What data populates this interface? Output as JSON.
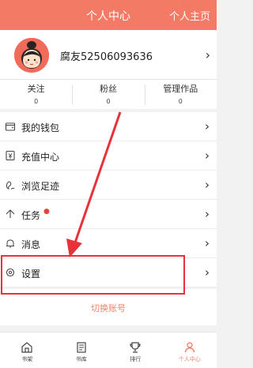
{
  "header": {
    "title": "个人中心",
    "homepage_link": "个人主页"
  },
  "profile": {
    "username": "腐友52506093636",
    "avatar_icon": "cartoon-avatar-icon"
  },
  "stats": [
    {
      "label": "关注",
      "value": "0"
    },
    {
      "label": "粉丝",
      "value": "0"
    },
    {
      "label": "管理作品",
      "value": "0"
    }
  ],
  "menu": [
    {
      "label": "我的钱包",
      "icon": "wallet-icon"
    },
    {
      "label": "充值中心",
      "icon": "recharge-icon"
    },
    {
      "label": "浏览足迹",
      "icon": "footprint-icon"
    },
    {
      "label": "任务",
      "icon": "task-icon",
      "badge": "●"
    },
    {
      "label": "消息",
      "icon": "bell-icon"
    },
    {
      "label": "设置",
      "icon": "gear-icon"
    }
  ],
  "switch_account": "切换账号",
  "tabs": [
    {
      "label": "书架",
      "icon": "bookshelf-icon"
    },
    {
      "label": "书库",
      "icon": "library-icon"
    },
    {
      "label": "排行",
      "icon": "trophy-icon"
    },
    {
      "label": "个人中心",
      "icon": "person-icon",
      "active": true
    }
  ],
  "colors": {
    "accent": "#f37a64",
    "annotation": "#e8323a"
  }
}
